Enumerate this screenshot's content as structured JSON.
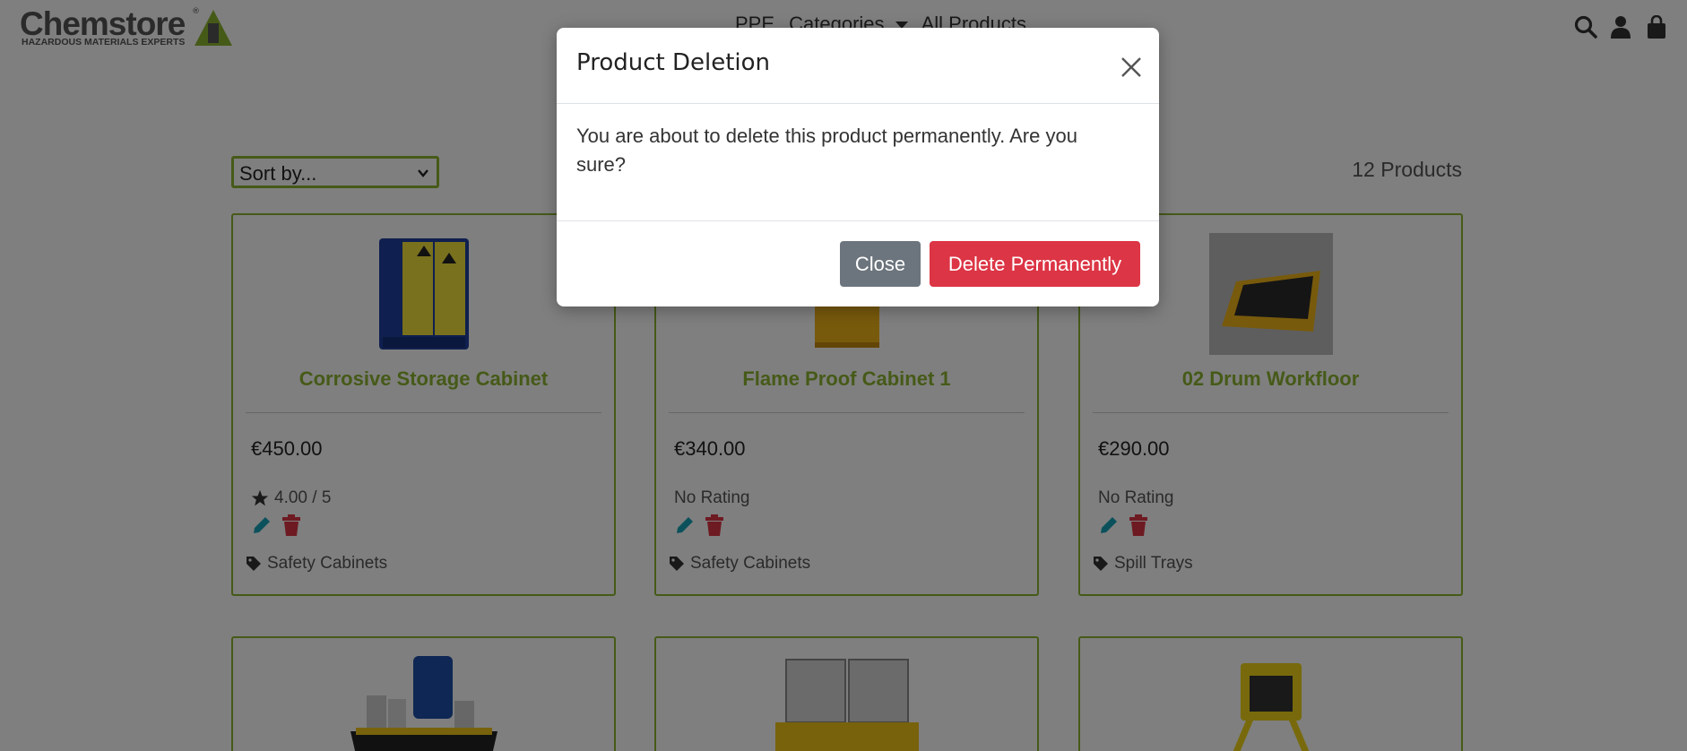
{
  "brand": {
    "name": "Chemstore",
    "registered": "®",
    "tagline": "HAZARDOUS MATERIALS EXPERTS"
  },
  "nav": {
    "items": [
      "PPE",
      "Categories",
      "All Products"
    ]
  },
  "colors": {
    "accent": "#8cb431",
    "danger": "#dc3545",
    "secondary": "#6c757d",
    "edit_icon": "#17a2b8"
  },
  "header_icons": [
    "search-icon",
    "user-icon",
    "shopping-bag-icon"
  ],
  "toolbar": {
    "sort_placeholder": "Sort by...",
    "product_count": "12 Products"
  },
  "products": [
    {
      "title": "Corrosive Storage Cabinet",
      "price": "€450.00",
      "rating": "4.00 / 5",
      "category": "Safety Cabinets"
    },
    {
      "title": "Flame Proof Cabinet 1",
      "price": "€340.00",
      "rating": "No Rating",
      "category": "Safety Cabinets"
    },
    {
      "title": "02 Drum Workfloor",
      "price": "€290.00",
      "rating": "No Rating",
      "category": "Spill Trays"
    }
  ],
  "modal": {
    "title": "Product Deletion",
    "body": "You are about to delete this product permanently. Are you sure?",
    "close_label": "Close",
    "delete_label": "Delete Permanently"
  }
}
